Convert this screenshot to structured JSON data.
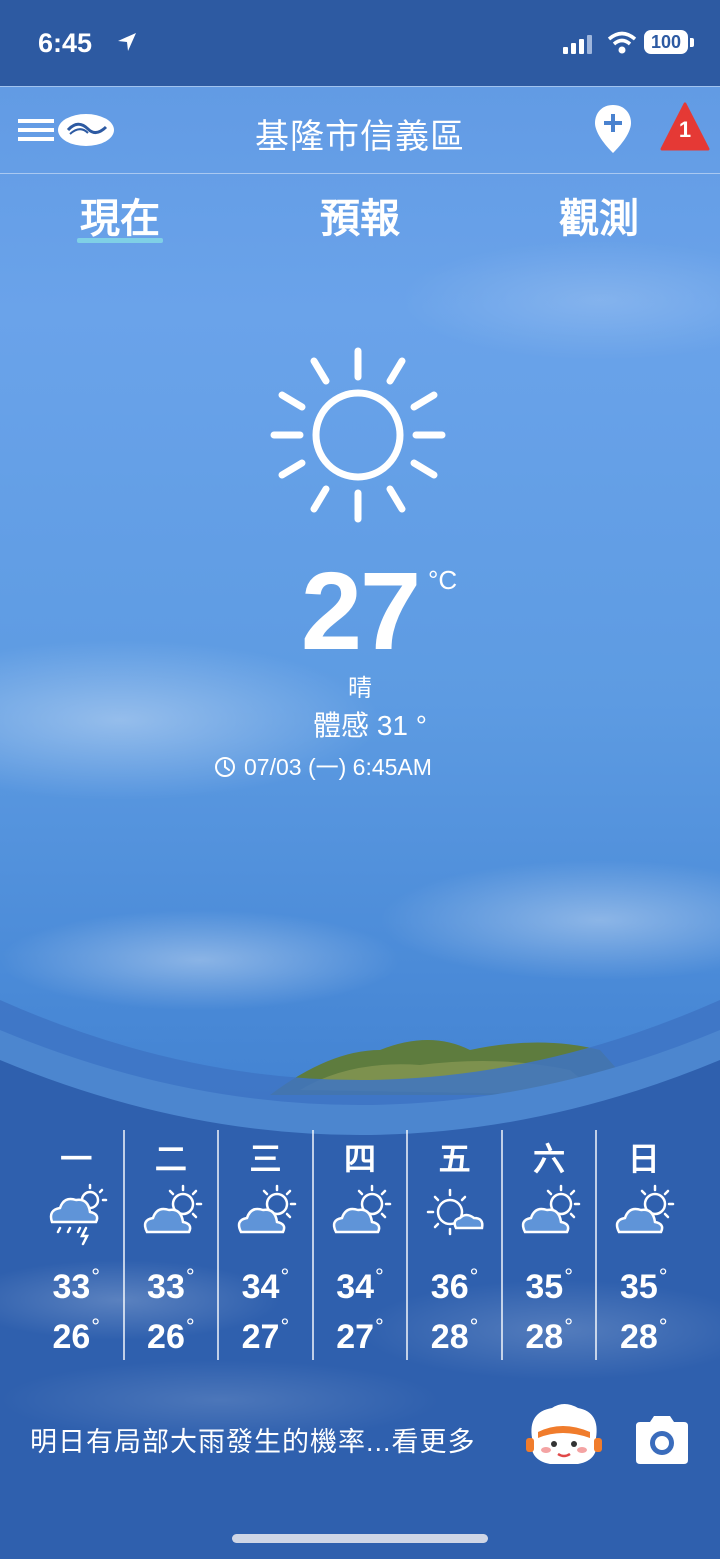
{
  "status_bar": {
    "time": "6:45",
    "battery": "100"
  },
  "header": {
    "location_title": "基隆市信義區",
    "alert_count": "1"
  },
  "tabs": [
    {
      "label": "現在"
    },
    {
      "label": "預報"
    },
    {
      "label": "觀測"
    }
  ],
  "current": {
    "temperature": "27",
    "unit": "°C",
    "condition": "晴",
    "feels_like": "體感 31 °",
    "updated": "07/03 (一) 6:45AM",
    "icon": "sun-icon"
  },
  "forecast": [
    {
      "day": "一",
      "high": "33",
      "low": "26",
      "icon": "thunderstorm-icon"
    },
    {
      "day": "二",
      "high": "33",
      "low": "26",
      "icon": "partly-cloudy-icon"
    },
    {
      "day": "三",
      "high": "34",
      "low": "27",
      "icon": "partly-cloudy-icon"
    },
    {
      "day": "四",
      "high": "34",
      "low": "27",
      "icon": "partly-cloudy-icon"
    },
    {
      "day": "五",
      "high": "36",
      "low": "28",
      "icon": "mostly-sunny-icon"
    },
    {
      "day": "六",
      "high": "35",
      "low": "28",
      "icon": "partly-cloudy-icon"
    },
    {
      "day": "日",
      "high": "35",
      "low": "28",
      "icon": "partly-cloudy-icon"
    }
  ],
  "bottom_message": "明日有局部大雨發生的機率...看更多",
  "colors": {
    "status_bar": "#2d5aa2",
    "tab_underline": "#7fd0e6",
    "alert_red": "#e53935"
  }
}
